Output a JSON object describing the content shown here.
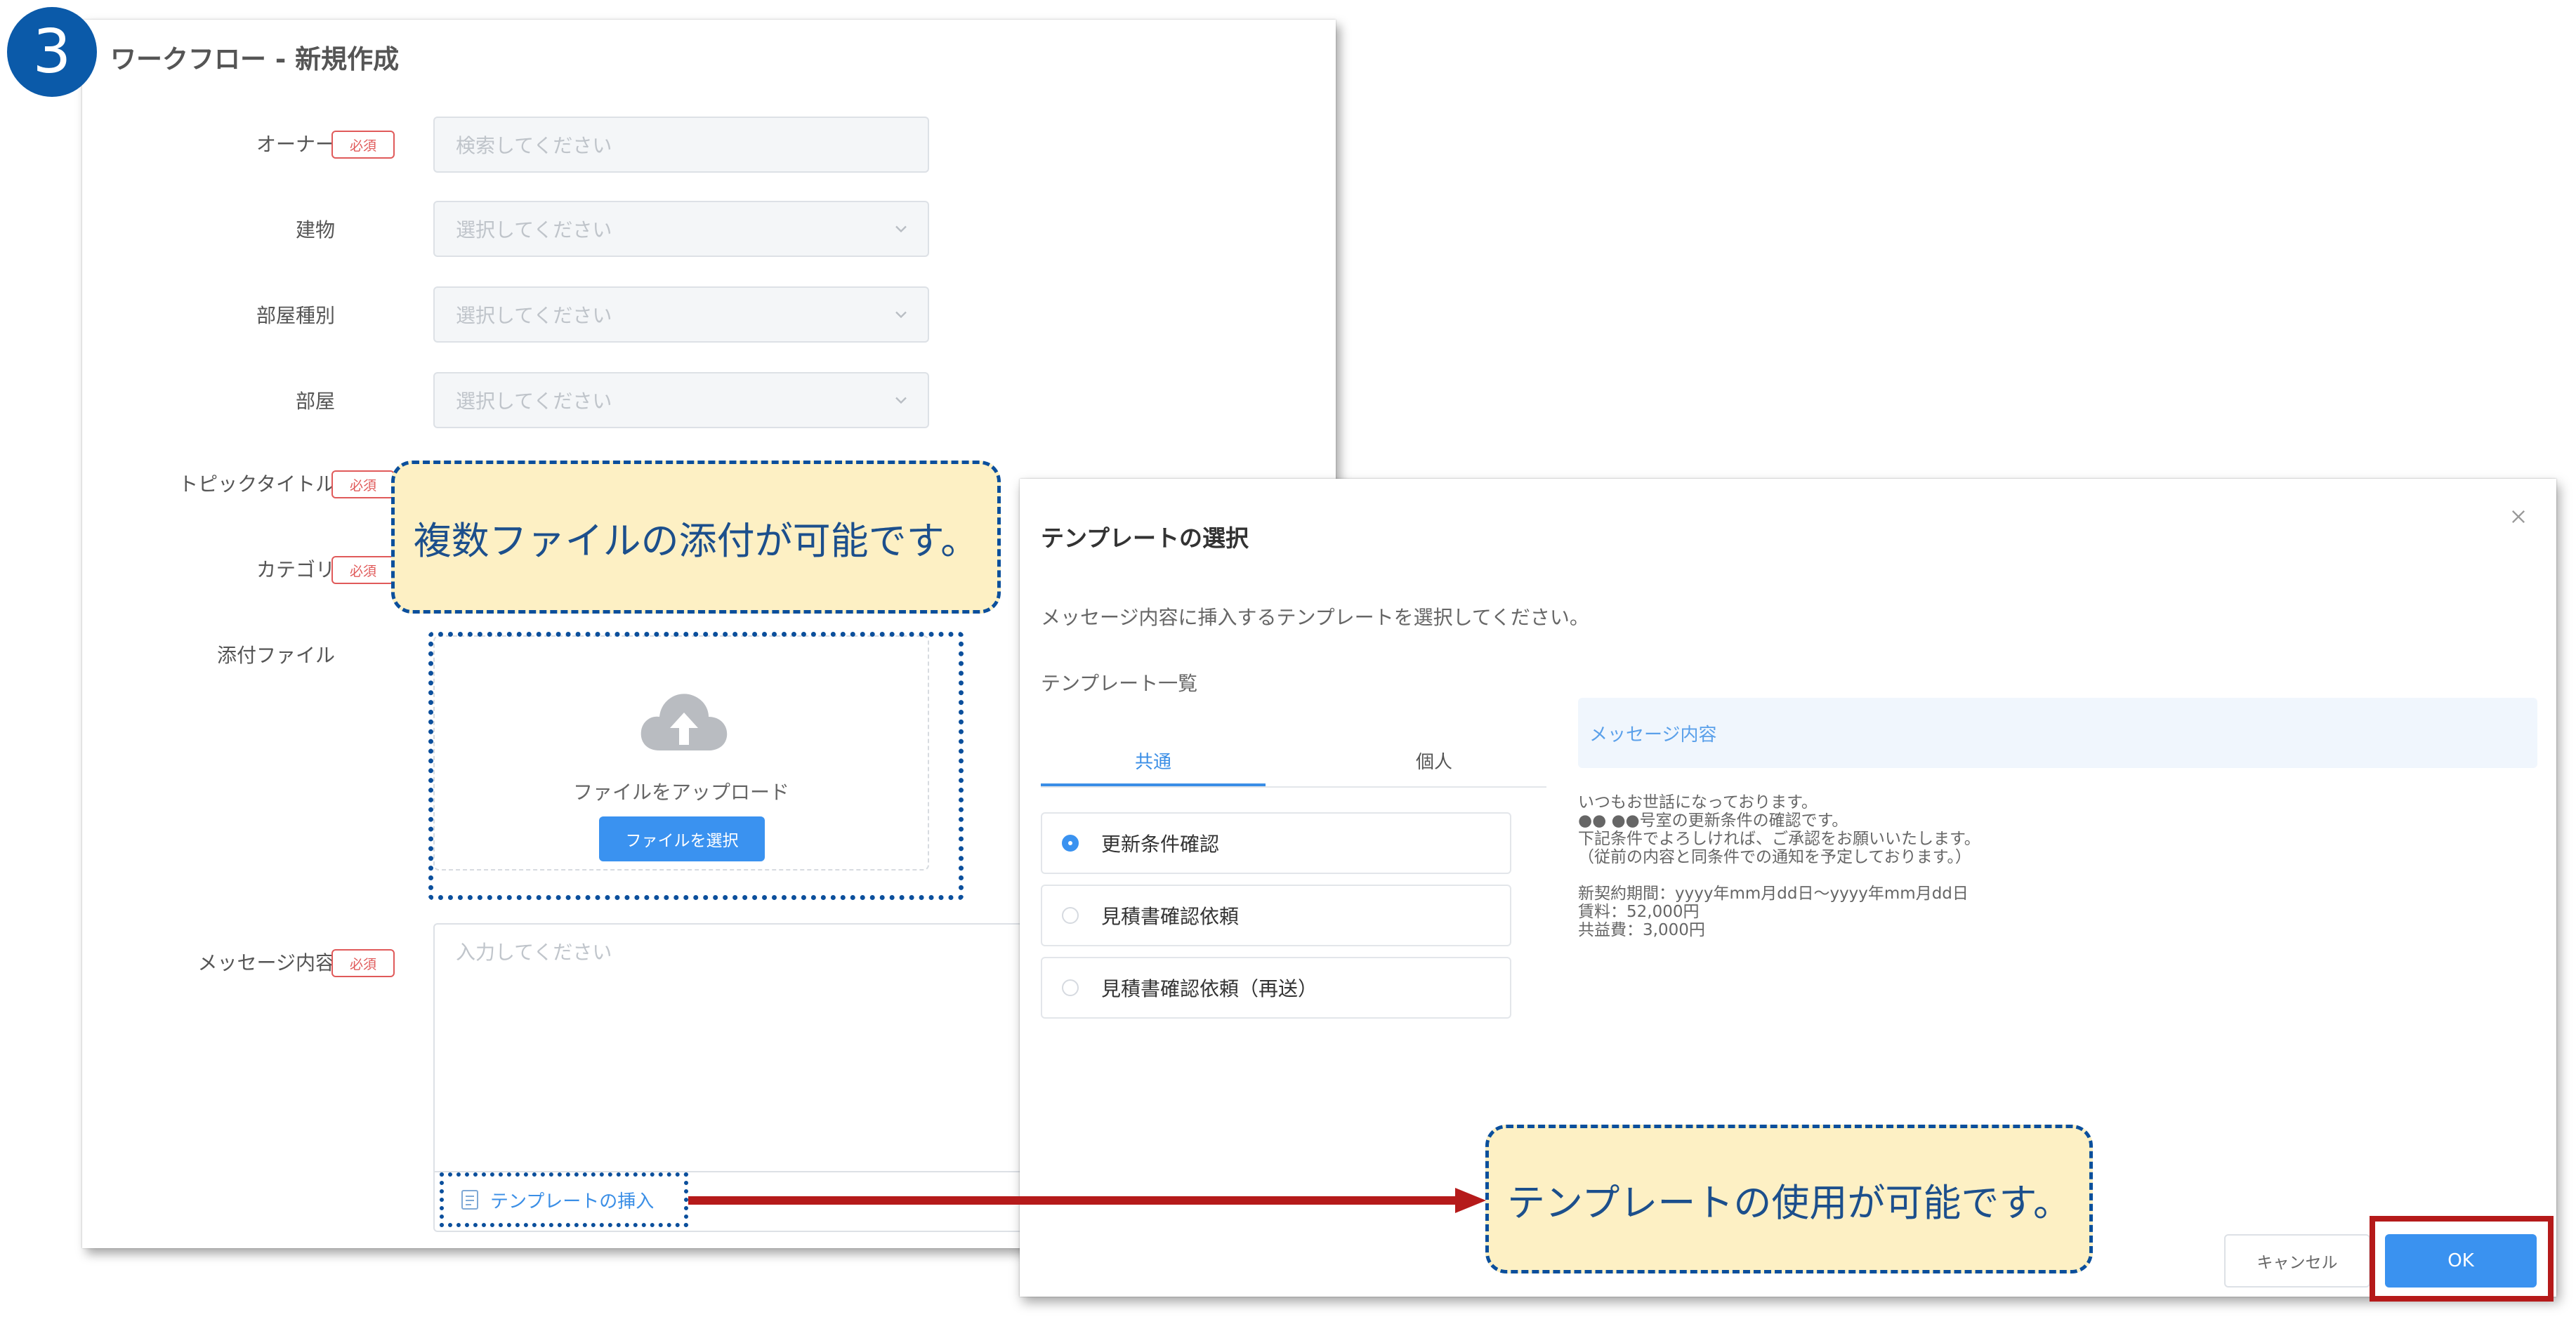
{
  "step_number": "3",
  "form": {
    "title": "ワークフロー - 新規作成",
    "required_label": "必須",
    "fields": {
      "owner": {
        "label": "オーナー",
        "placeholder": "検索してください"
      },
      "building": {
        "label": "建物",
        "placeholder": "選択してください"
      },
      "room_type": {
        "label": "部屋種別",
        "placeholder": "選択してください"
      },
      "room": {
        "label": "部屋",
        "placeholder": "選択してください"
      },
      "topic_title": {
        "label": "トピックタイトル"
      },
      "category": {
        "label": "カテゴリ"
      },
      "attachment": {
        "label": "添付ファイル",
        "upload_text": "ファイルをアップロード",
        "select_button": "ファイルを選択"
      },
      "message": {
        "label": "メッセージ内容",
        "placeholder": "入力してください",
        "insert_template": "テンプレートの挿入"
      }
    }
  },
  "callouts": {
    "attachment": "複数ファイルの添付が可能です。",
    "template": "テンプレートの使用が可能です。"
  },
  "modal": {
    "title": "テンプレートの選択",
    "description": "メッセージ内容に挿入するテンプレートを選択してください。",
    "list_title": "テンプレート一覧",
    "tabs": [
      {
        "label": "共通",
        "active": true
      },
      {
        "label": "個人",
        "active": false
      }
    ],
    "templates": [
      {
        "label": "更新条件確認",
        "selected": true
      },
      {
        "label": "見積書確認依頼",
        "selected": false
      },
      {
        "label": "見積書確認依頼（再送）",
        "selected": false
      }
    ],
    "preview_label": "メッセージ内容",
    "preview_lines": [
      "いつもお世話になっております。",
      "●● ●●号室の更新条件の確認です。",
      "下記条件でよろしければ、ご承認をお願いいたします。",
      "（従前の内容と同条件での通知を予定しております。）"
    ],
    "preview_lines_2": [
      "新契約期間：yyyy年mm月dd日〜yyyy年mm月dd日",
      "賃料：52,000円",
      "共益費：3,000円"
    ],
    "cancel_label": "キャンセル",
    "ok_label": "OK"
  },
  "colors": {
    "primary": "#3a92f0",
    "badge": "#0b5aa9",
    "required": "#e05a5a",
    "highlight": "#b51a1a",
    "callout_bg": "#fdf0c4"
  }
}
